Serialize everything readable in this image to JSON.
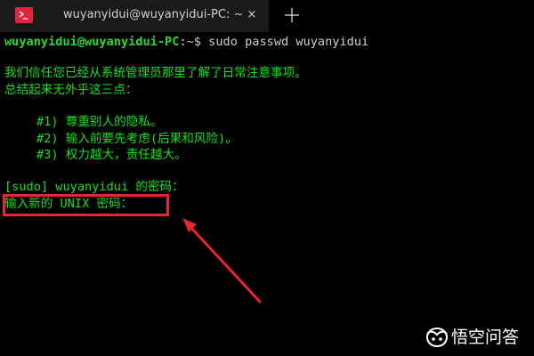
{
  "tab": {
    "icon": "terminal-icon",
    "title": "wuyanyidui@wuyanyidui-PC: ~",
    "close_label": "×",
    "new_tab_icon": "plus-icon"
  },
  "terminal": {
    "prompt_user": "wuyanyidui@wuyanyidui-PC",
    "prompt_sep": ":~$",
    "prompt_cmd": " sudo passwd wuyanyidui",
    "message_line1": "我们信任您已经从系统管理员那里了解了日常注意事项。",
    "message_line2": "总结起来无外乎这三点：",
    "rules": [
      "#1) 尊重别人的隐私。",
      "#2) 输入前要先考虑(后果和风险)。",
      "#3) 权力越大，责任越大。"
    ],
    "sudo_prompt": "[sudo] wuyanyidui 的密码：",
    "new_password_prompt": "输入新的 UNIX 密码："
  },
  "watermark": {
    "text": "悟空问答",
    "icon": "wukong-logo-icon"
  },
  "colors": {
    "background": "#000000",
    "terminal_text": "#15e21c",
    "prompt_user": "#2ad92f",
    "command_text": "#cfcfcf",
    "tab_background": "#1a1a1a",
    "tab_icon": "#e1243b",
    "annotation": "#e8262e"
  }
}
